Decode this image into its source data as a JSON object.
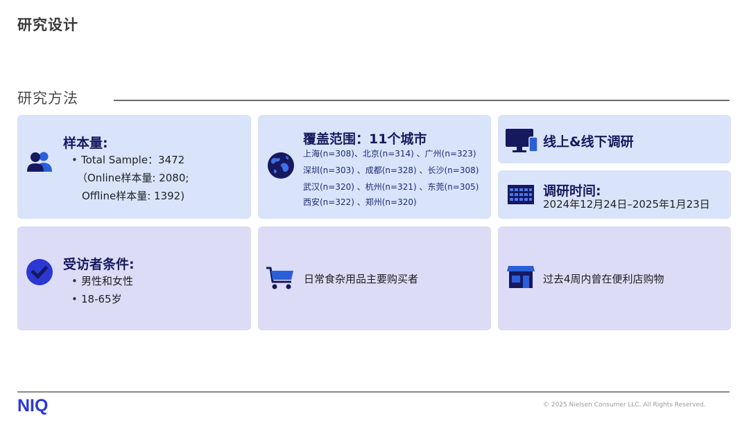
{
  "page": {
    "title": "研究设计"
  },
  "section": {
    "title": "研究方法"
  },
  "sample": {
    "heading": "样本量:",
    "line1": "Total Sample：3472",
    "line2": "（Online样本量: 2080;",
    "line3": "Offline样本量: 1392)"
  },
  "coverage": {
    "heading": "覆盖范围：11个城市",
    "row1": "上海(n=308)、北京(n=314) 、广州(n=323)",
    "row2": "深圳(n=303) 、成都(n=328) 、长沙(n=308)",
    "row3": "武汉(n=320) 、杭州(n=321) 、东莞(n=305)",
    "row4": "西安(n=322) 、郑州(n=320)"
  },
  "mode": {
    "heading": "线上&线下调研"
  },
  "period": {
    "heading": "调研时间:",
    "dates": "2024年12月24日–2025年1月23日"
  },
  "respondent": {
    "heading": "受访者条件:",
    "items": [
      "男性和女性",
      "18-65岁"
    ]
  },
  "shopper": {
    "text": "日常食杂用品主要购买者"
  },
  "store": {
    "text": "过去4周内曾在便利店购物"
  },
  "footer": {
    "logo": "NIQ",
    "copyright": "© 2025 Nielsen Consumer LLC. All Rights Reserved."
  },
  "colors": {
    "accent": "#2b38d4",
    "heading": "#16195e",
    "card_blue": "#d9e4fb",
    "card_lavender": "#dcdcf7"
  },
  "icons": [
    "users-icon",
    "globe-icon",
    "monitor-phone-icon",
    "calendar-icon",
    "checkmark-icon",
    "shopping-cart-icon",
    "store-icon"
  ]
}
